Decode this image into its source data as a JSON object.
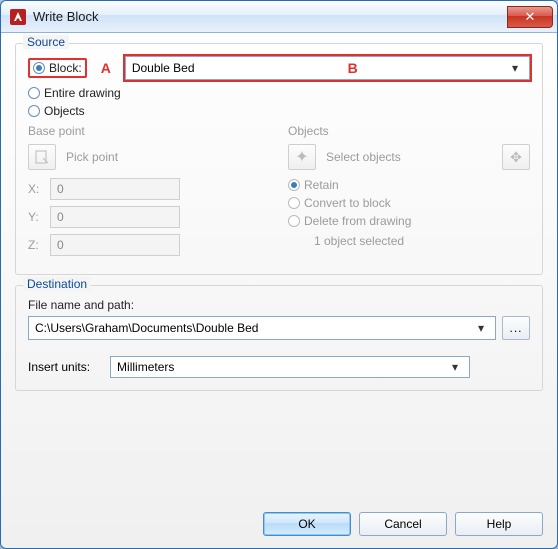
{
  "window": {
    "title": "Write Block",
    "close_glyph": "✕"
  },
  "annotation": {
    "a": "A",
    "b": "B"
  },
  "source": {
    "group_label": "Source",
    "block_label": "Block:",
    "block_selected": true,
    "block_combo_value": "Double Bed",
    "entire_drawing_label": "Entire drawing",
    "objects_label": "Objects",
    "base_point": {
      "label": "Base point",
      "pick_point_label": "Pick point",
      "x_label": "X:",
      "x": "0",
      "y_label": "Y:",
      "y": "0",
      "z_label": "Z:",
      "z": "0"
    },
    "objects": {
      "label": "Objects",
      "select_objects_label": "Select objects",
      "retain_label": "Retain",
      "convert_label": "Convert to block",
      "delete_label": "Delete from drawing",
      "status": "1 object selected"
    }
  },
  "destination": {
    "group_label": "Destination",
    "path_label": "File name and path:",
    "path_value": "C:\\Users\\Graham\\Documents\\Double Bed",
    "browse_label": "...",
    "units_label": "Insert units:",
    "units_value": "Millimeters"
  },
  "buttons": {
    "ok": "OK",
    "cancel": "Cancel",
    "help": "Help"
  }
}
